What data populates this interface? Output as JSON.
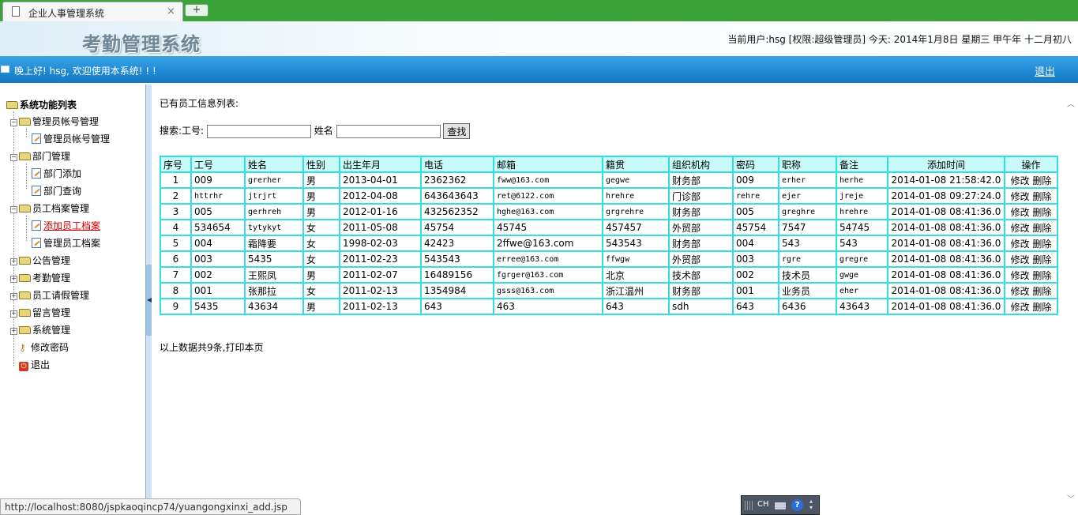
{
  "browser": {
    "tab_title": "企业人事管理系统",
    "close_glyph": "×",
    "new_tab_glyph": "+"
  },
  "header": {
    "system_title": "考勤管理系统",
    "user_info": "当前用户:hsg [权限:超级管理员] 今天: 2014年1月8日 星期三 甲午年 十二月初八"
  },
  "bar": {
    "welcome": "晚上好! hsg, 欢迎使用本系统! ! !",
    "logout": "退出"
  },
  "sidebar": {
    "root": "系统功能列表",
    "g1": "管理员帐号管理",
    "g1_i1": "管理员帐号管理",
    "g2": "部门管理",
    "g2_i1": "部门添加",
    "g2_i2": "部门查询",
    "g3": "员工档案管理",
    "g3_i1": "添加员工档案",
    "g3_i2": "管理员工档案",
    "g4": "公告管理",
    "g5": "考勤管理",
    "g6": "员工请假管理",
    "g7": "留言管理",
    "g8": "系统管理",
    "change_password": "修改密码",
    "exit": "退出"
  },
  "main": {
    "list_title": "已有员工信息列表:",
    "search_label": "搜索:工号:",
    "name_label": "姓名",
    "search_button": "查找",
    "footer": "以上数据共9条,打印本页",
    "headers": [
      "序号",
      "工号",
      "姓名",
      "性别",
      "出生年月",
      "电话",
      "邮箱",
      "籍贯",
      "组织机构",
      "密码",
      "职称",
      "备注",
      "添加时间",
      "操作"
    ],
    "edit_label": "修改",
    "delete_label": "删除",
    "rows": [
      [
        "1",
        "009",
        "grerher",
        "男",
        "2013-04-01",
        "2362362",
        "fww@163.com",
        "gegwe",
        "财务部",
        "009",
        "erher",
        "herhe",
        "2014-01-08 21:58:42.0"
      ],
      [
        "2",
        "httrhr",
        "jtrjrt",
        "男",
        "2012-04-08",
        "643643643",
        "ret@6122.com",
        "hrehre",
        "门诊部",
        "rehre",
        "ejer",
        "jreje",
        "2014-01-08 09:27:24.0"
      ],
      [
        "3",
        "005",
        "gerhreh",
        "男",
        "2012-01-16",
        "432562352",
        "hghe@163.com",
        "grgrehre",
        "财务部",
        "005",
        "greghre",
        "hrehre",
        "2014-01-08 08:41:36.0"
      ],
      [
        "4",
        "534654",
        "tytykyt",
        "女",
        "2011-05-08",
        "45754",
        "45745",
        "457457",
        "外贸部",
        "45754",
        "7547",
        "54745",
        "2014-01-08 08:41:36.0"
      ],
      [
        "5",
        "004",
        "霜降要",
        "女",
        "1998-02-03",
        "42423",
        "2ffwe@163.com",
        "543543",
        "财务部",
        "004",
        "543",
        "543",
        "2014-01-08 08:41:36.0"
      ],
      [
        "6",
        "003",
        "5435",
        "女",
        "2011-02-23",
        "543543",
        "erree@163.com",
        "ffwgw",
        "外贸部",
        "003",
        "rgre",
        "gregre",
        "2014-01-08 08:41:36.0"
      ],
      [
        "7",
        "002",
        "王熙凤",
        "男",
        "2011-02-07",
        "16489156",
        "fgrger@163.com",
        "北京",
        "技术部",
        "002",
        "技术员",
        "gwge",
        "2014-01-08 08:41:36.0"
      ],
      [
        "8",
        "001",
        "张那拉",
        "女",
        "2011-02-13",
        "1354984",
        "gsss@163.com",
        "浙江温州",
        "财务部",
        "001",
        "业务员",
        "eher",
        "2014-01-08 08:41:36.0"
      ],
      [
        "9",
        "5435",
        "43634",
        "男",
        "2011-02-13",
        "643",
        "463",
        "643",
        "sdh",
        "643",
        "6436",
        "43643",
        "2014-01-08 08:41:36.0"
      ]
    ]
  },
  "status": {
    "url": "http://localhost:8080/jspkaoqincp74/yuangongxinxi_add.jsp"
  },
  "ime": {
    "lang": "CH",
    "help": "?"
  }
}
